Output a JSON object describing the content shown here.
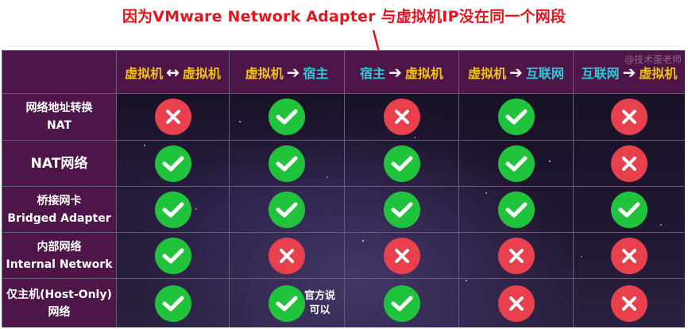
{
  "annotation": {
    "text": "因为VMware Network Adapter 与虚拟机IP没在同一个网段"
  },
  "watermark": "@技术蛋老师",
  "columns": [
    {
      "left": "虚拟机",
      "arrow": "↔",
      "right": "虚拟机",
      "left_color": "yellow",
      "right_color": "yellow"
    },
    {
      "left": "虚拟机",
      "arrow": "➔",
      "right": "宿主",
      "left_color": "yellow",
      "right_color": "cyan"
    },
    {
      "left": "宿主",
      "arrow": "➔",
      "right": "虚拟机",
      "left_color": "cyan",
      "right_color": "yellow"
    },
    {
      "left": "虚拟机",
      "arrow": "➔",
      "right": "互联网",
      "left_color": "yellow",
      "right_color": "cyan"
    },
    {
      "left": "互联网",
      "arrow": "➔",
      "right": "虚拟机",
      "left_color": "cyan",
      "right_color": "yellow"
    }
  ],
  "rows": [
    {
      "line1": "网络地址转换",
      "line2": "NAT",
      "values": [
        "no",
        "yes",
        "no",
        "yes",
        "no"
      ]
    },
    {
      "line1": "NAT网络",
      "line2": "",
      "values": [
        "yes",
        "yes",
        "yes",
        "yes",
        "no"
      ]
    },
    {
      "line1": "桥接网卡",
      "line2": "Bridged Adapter",
      "values": [
        "yes",
        "yes",
        "yes",
        "yes",
        "yes"
      ]
    },
    {
      "line1": "内部网络",
      "line2": "Internal Network",
      "values": [
        "yes",
        "no",
        "no",
        "no",
        "no"
      ]
    },
    {
      "line1": "仅主机(Host-Only)",
      "line2": "网络",
      "values": [
        "yes",
        "yes",
        "yes",
        "no",
        "no"
      ]
    }
  ],
  "note": {
    "line1": "官方说",
    "line2": "可以"
  },
  "colors": {
    "yes": "#21c33c",
    "no": "#e8404d",
    "header_bg": "#4e1548",
    "yellow": "#f2c01d",
    "cyan": "#2fc9d8",
    "annotation": "#e8141b"
  }
}
